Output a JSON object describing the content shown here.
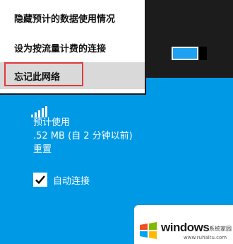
{
  "menu": {
    "items": [
      {
        "label": "隐藏预计的数据使用情况"
      },
      {
        "label": "设为按流量计费的连接"
      },
      {
        "label": "忘记此网络"
      }
    ]
  },
  "network": {
    "usage_label": "预计使用",
    "usage_value": ".52 MB (自 2 分钟以前)",
    "reset_label": "重置",
    "auto_connect_label": "自动连接",
    "auto_connect_checked": true
  },
  "toggle": {
    "state": "on"
  },
  "watermark": {
    "title": "windows",
    "subtitle": "系统家园",
    "url": "www.ruhaitu.com"
  },
  "colors": {
    "accent": "#0099e6",
    "menu_bg": "#ffffff",
    "highlight": "#e0393b",
    "top_strip": "#1c1c1c"
  }
}
